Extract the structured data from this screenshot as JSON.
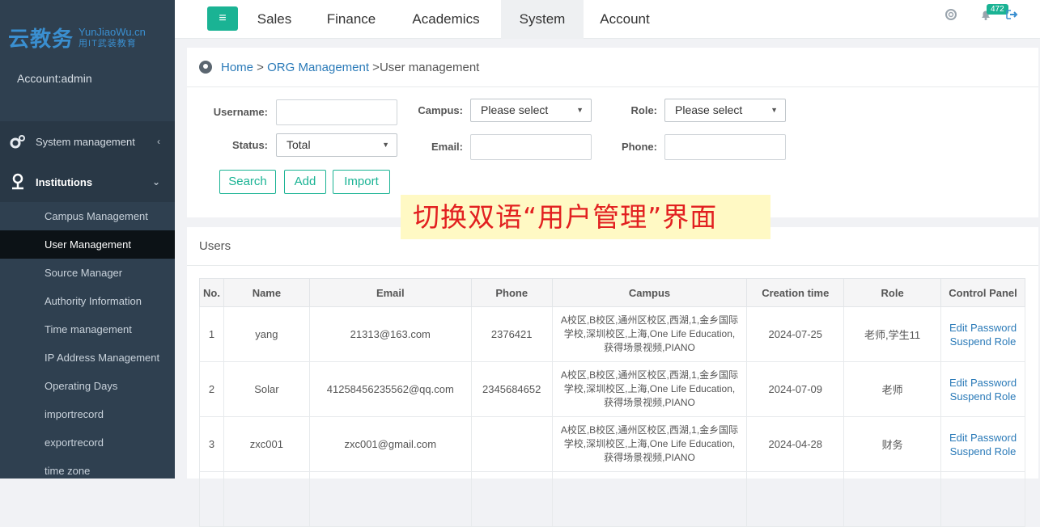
{
  "logo": {
    "main": "云教务",
    "sub1": "YunJiaoWu.cn",
    "sub2": "用IT武装教育"
  },
  "account": "Account:admin",
  "sidebar": {
    "parents": [
      {
        "label": "System management",
        "caret": "‹"
      },
      {
        "label": "Institutions",
        "caret": "⌄"
      }
    ],
    "items": [
      {
        "label": "Campus Management"
      },
      {
        "label": "User Management"
      },
      {
        "label": "Source Manager"
      },
      {
        "label": "Authority Information"
      },
      {
        "label": "Time management"
      },
      {
        "label": "IP Address Management"
      },
      {
        "label": "Operating Days"
      },
      {
        "label": "importrecord"
      },
      {
        "label": "exportrecord"
      },
      {
        "label": "time zone"
      }
    ]
  },
  "topnav": {
    "hamburger": "≡",
    "items": [
      {
        "label": "Sales"
      },
      {
        "label": "Finance"
      },
      {
        "label": "Academics"
      },
      {
        "label": "System"
      },
      {
        "label": "Account"
      }
    ],
    "badge": "472"
  },
  "breadcrumb": {
    "home": "Home",
    "sep1": " > ",
    "org": "ORG Management",
    "sep2": " >",
    "current": "User management"
  },
  "filters": {
    "username_label": "Username:",
    "campus_label": "Campus:",
    "role_label": "Role:",
    "status_label": "Status:",
    "email_label": "Email:",
    "phone_label": "Phone:",
    "campus_value": "Please select",
    "role_value": "Please select",
    "status_value": "Total"
  },
  "buttons": {
    "search": "Search",
    "add": "Add",
    "import": "Import"
  },
  "overlay": "切换双语“用户管理”界面",
  "users_panel": {
    "title": "Users"
  },
  "table": {
    "headers": [
      "No.",
      "Name",
      "Email",
      "Phone",
      "Campus",
      "Creation time",
      "Role",
      "Control Panel"
    ],
    "rows": [
      {
        "no": "1",
        "name": "yang",
        "email": "21313@163.com",
        "phone": "2376421",
        "campus": "A校区,B校区,通州区校区,西湖,1,金乡国际学校,深圳校区,上海,One Life Education,获得场景视频,PIANO",
        "created": "2024-07-25",
        "role": "老师,学生11",
        "edit": "Edit Password",
        "suspend": "Suspend Role"
      },
      {
        "no": "2",
        "name": "Solar",
        "email": "41258456235562@qq.com",
        "phone": "2345684652",
        "campus": "A校区,B校区,通州区校区,西湖,1,金乡国际学校,深圳校区,上海,One Life Education,获得场景视频,PIANO",
        "created": "2024-07-09",
        "role": "老师",
        "edit": "Edit Password",
        "suspend": "Suspend Role"
      },
      {
        "no": "3",
        "name": "zxc001",
        "email": "zxc001@gmail.com",
        "phone": "",
        "campus": "A校区,B校区,通州区校区,西湖,1,金乡国际学校,深圳校区,上海,One Life Education,获得场景视频,PIANO",
        "created": "2024-04-28",
        "role": "财务",
        "edit": "Edit Password",
        "suspend": "Suspend Role"
      }
    ]
  },
  "colors": {
    "sidebar": "#2f4050",
    "accent": "#1ab394",
    "link": "#2a7ab8",
    "overlay_bg": "#fff9c4",
    "overlay_text": "#e22020"
  }
}
